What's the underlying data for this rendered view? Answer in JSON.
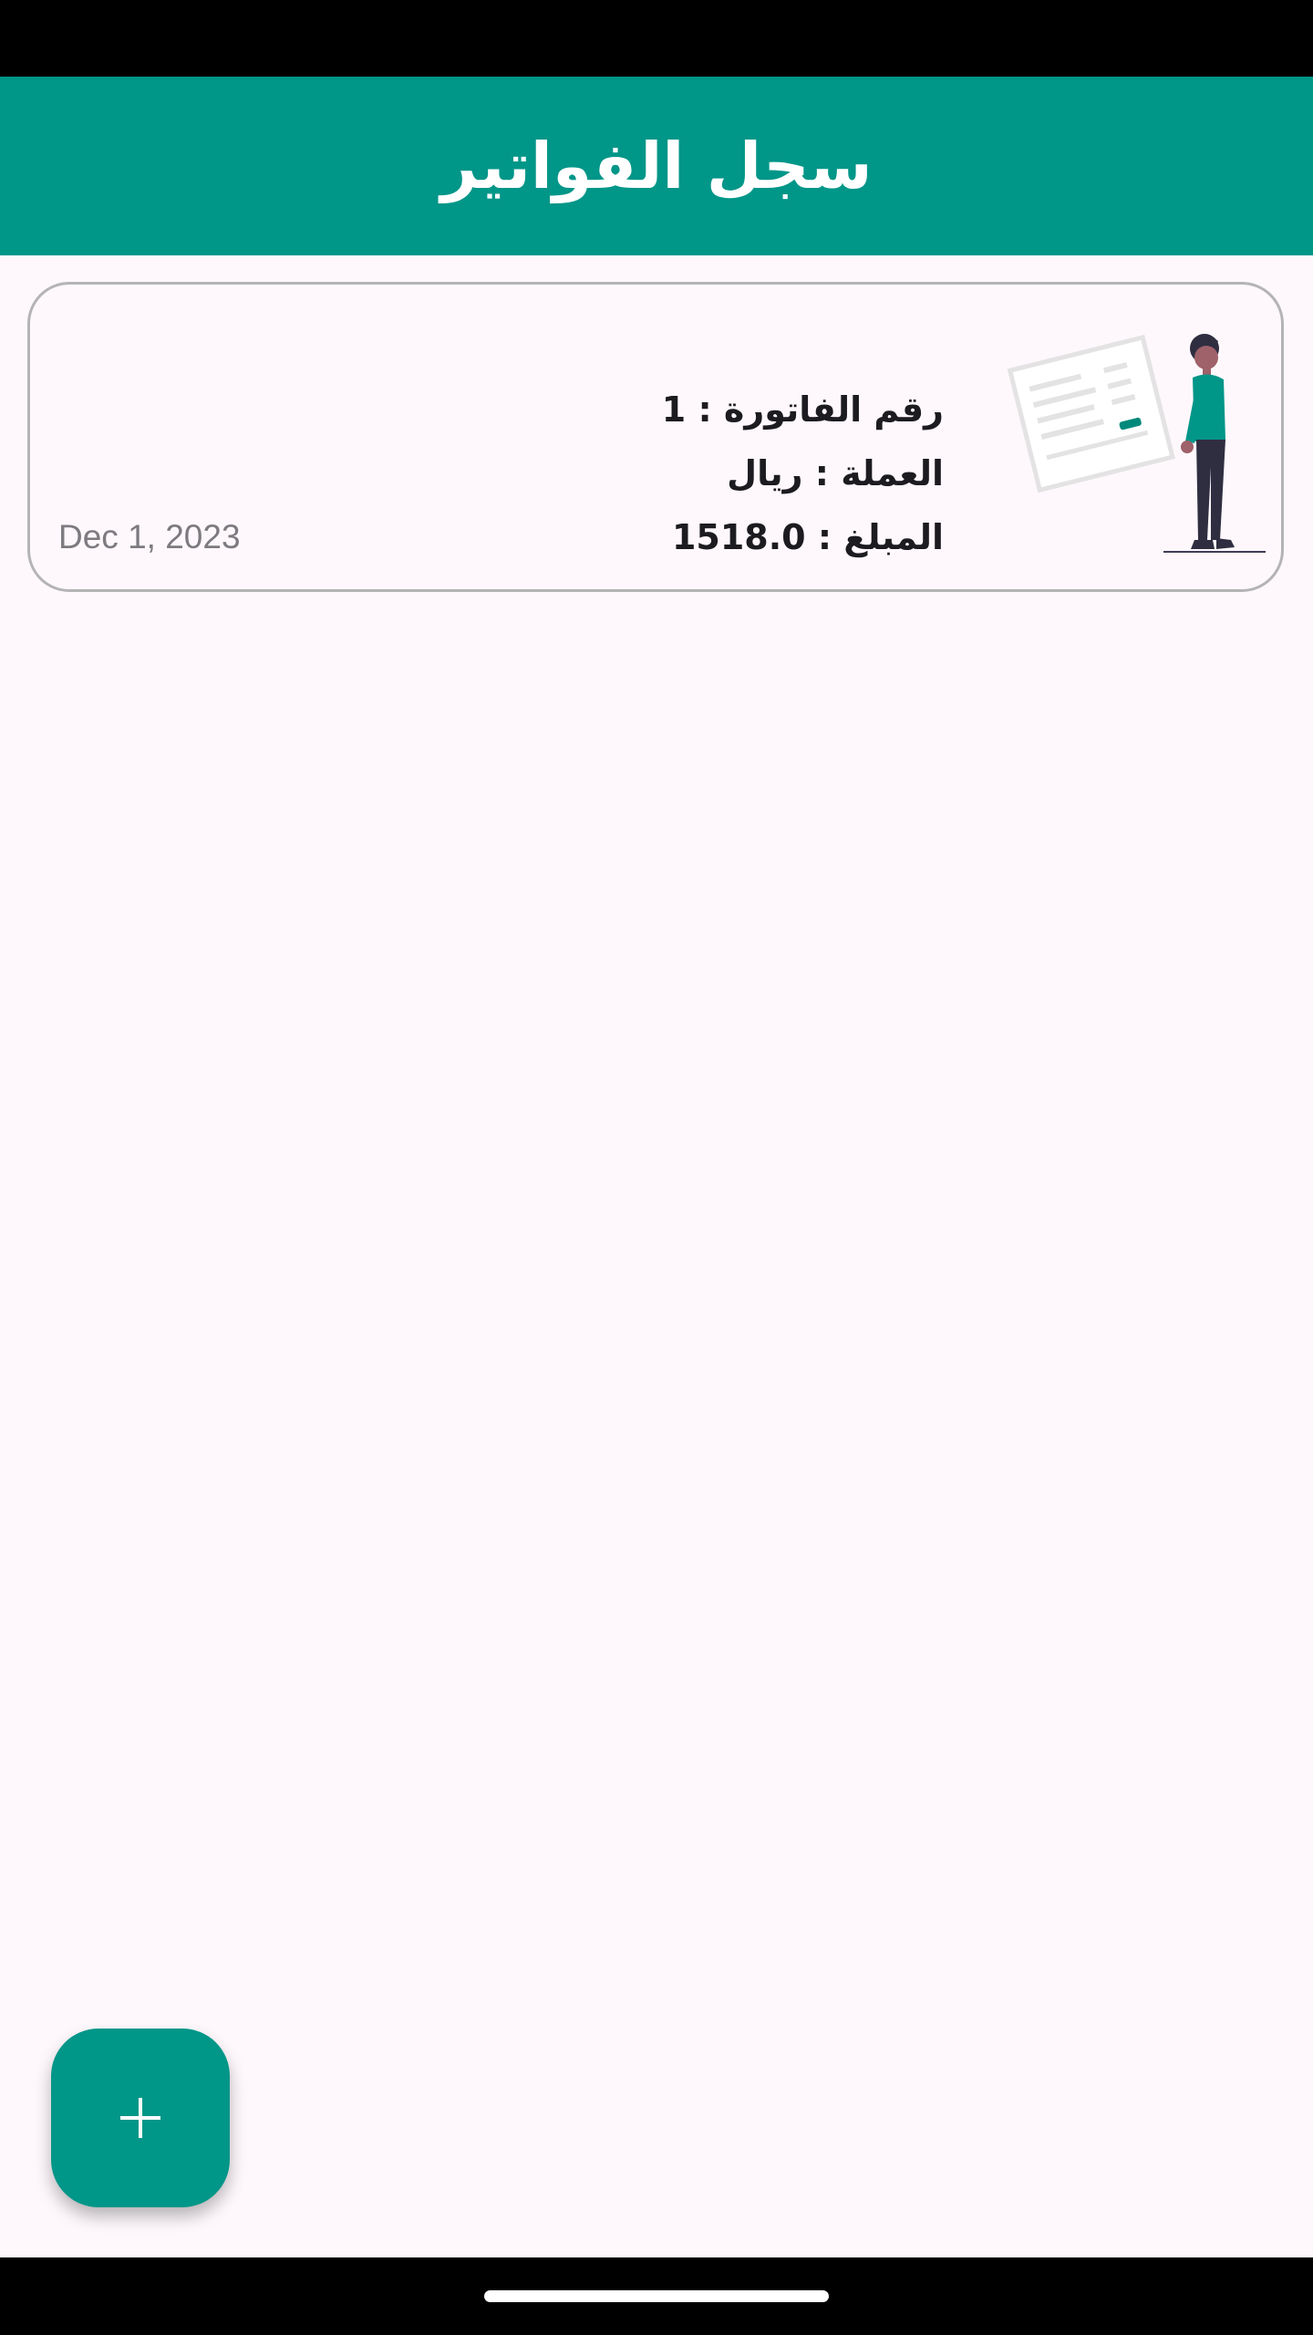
{
  "app_bar": {
    "title": "سجل الفواتير"
  },
  "invoices": [
    {
      "invoice_number_label": "رقم الفاتورة : 1",
      "currency_label": "العملة : ريال",
      "amount_label": "المبلغ : 1518.0",
      "date": "Dec 1, 2023",
      "illustration_icon": "person-with-invoice-icon"
    }
  ],
  "fab": {
    "icon": "plus-icon"
  },
  "colors": {
    "primary": "#009688",
    "background": "#FEF8FC",
    "card_border": "#B4B4B4",
    "date_text": "#7D7A80",
    "body_text": "#1C1B1F"
  }
}
